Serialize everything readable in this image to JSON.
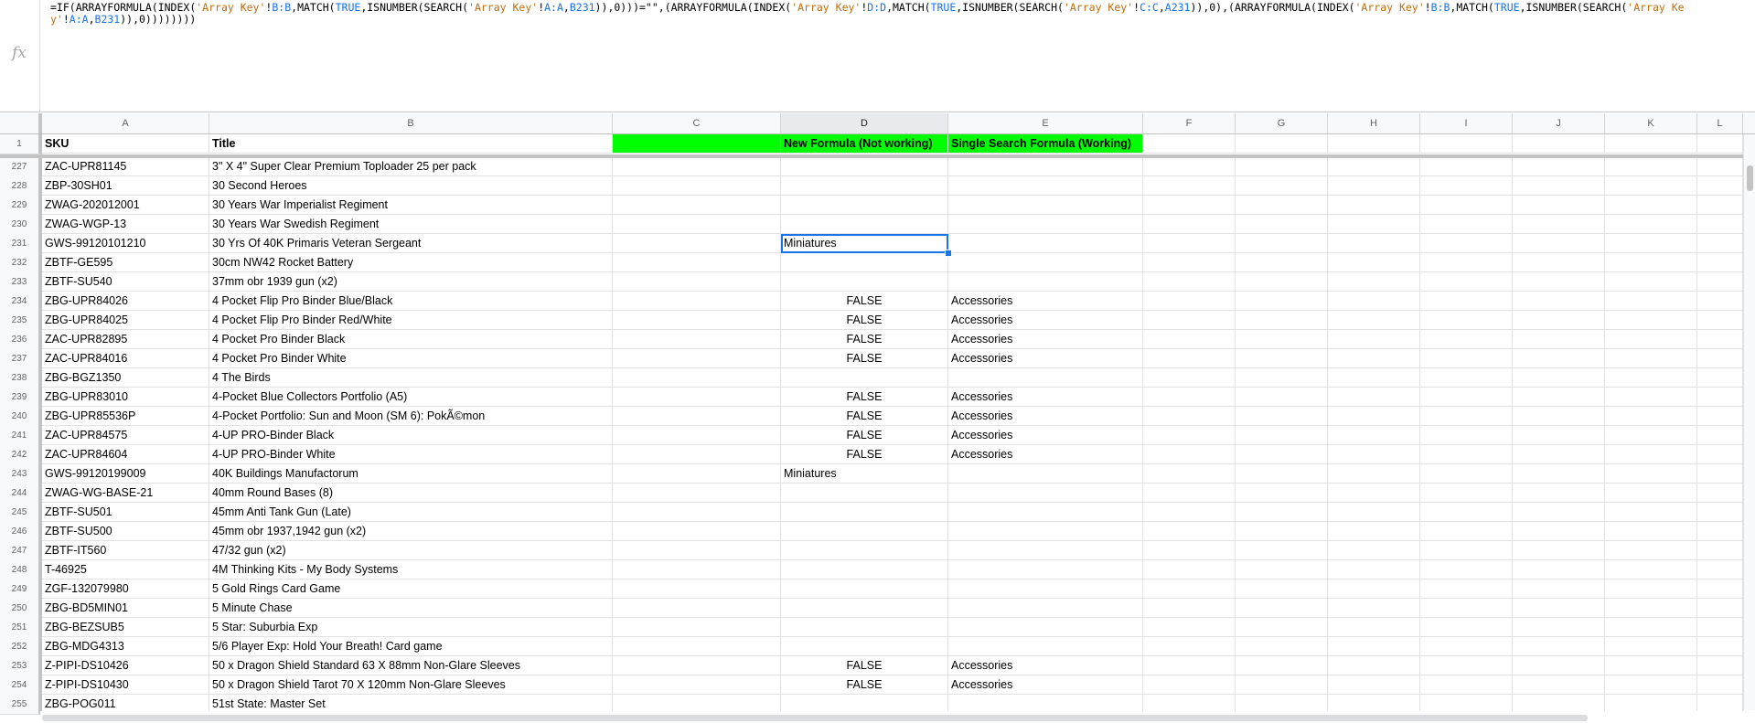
{
  "formula_bar": {
    "fx_label": "fx",
    "tokens": [
      {
        "t": "=IF(ARRAYFORMULA(INDEX(",
        "c": ""
      },
      {
        "t": "'Array Key'",
        "c": "str"
      },
      {
        "t": "!",
        "c": ""
      },
      {
        "t": "B:B",
        "c": "ref"
      },
      {
        "t": ",MATCH(",
        "c": ""
      },
      {
        "t": "TRUE",
        "c": "kw"
      },
      {
        "t": ",ISNUMBER(SEARCH(",
        "c": ""
      },
      {
        "t": "'Array Key'",
        "c": "str"
      },
      {
        "t": "!",
        "c": ""
      },
      {
        "t": "A:A",
        "c": "ref"
      },
      {
        "t": ",",
        "c": ""
      },
      {
        "t": "B231",
        "c": "ref"
      },
      {
        "t": ")),0)))=\"\",(ARRAYFORMULA(INDEX(",
        "c": ""
      },
      {
        "t": "'Array Key'",
        "c": "str"
      },
      {
        "t": "!",
        "c": ""
      },
      {
        "t": "D:D",
        "c": "ref"
      },
      {
        "t": ",MATCH(",
        "c": ""
      },
      {
        "t": "TRUE",
        "c": "kw"
      },
      {
        "t": ",ISNUMBER(SEARCH(",
        "c": ""
      },
      {
        "t": "'Array Key'",
        "c": "str"
      },
      {
        "t": "!",
        "c": ""
      },
      {
        "t": "C:C",
        "c": "ref"
      },
      {
        "t": ",",
        "c": ""
      },
      {
        "t": "A231",
        "c": "ref"
      },
      {
        "t": ")),0),(ARRAYFORMULA(INDEX(",
        "c": ""
      },
      {
        "t": "'Array Key'",
        "c": "str"
      },
      {
        "t": "!",
        "c": ""
      },
      {
        "t": "B:B",
        "c": "ref"
      },
      {
        "t": ",MATCH(",
        "c": ""
      },
      {
        "t": "TRUE",
        "c": "kw"
      },
      {
        "t": ",ISNUMBER(SEARCH(",
        "c": ""
      },
      {
        "t": "'Array Key'",
        "c": "str"
      },
      {
        "t": "!",
        "c": ""
      },
      {
        "t": "A:A",
        "c": "ref"
      },
      {
        "t": ",",
        "c": ""
      },
      {
        "t": "B231",
        "c": "ref"
      },
      {
        "t": ")),0))))))))",
        "c": ""
      }
    ]
  },
  "columns": [
    "A",
    "B",
    "C",
    "D",
    "E",
    "F",
    "G",
    "H",
    "I",
    "J",
    "K",
    "L"
  ],
  "selected_column": "D",
  "header_row": {
    "number": "1",
    "A": "SKU",
    "B": "Title",
    "C": "",
    "D": "New Formula (Not working)",
    "E": "Single Search Formula (Working)"
  },
  "colors": {
    "header_fill": "#00ff00",
    "selection": "#1a73e8",
    "string_token": "#bc6e10",
    "ref_token": "#1a73e8"
  },
  "selected_cell": "D231",
  "rows": [
    {
      "n": "227",
      "A": "ZAC-UPR81145",
      "B": "3\" X 4\" Super Clear Premium Toploader 25 per pack",
      "D": "",
      "E": ""
    },
    {
      "n": "228",
      "A": "ZBP-30SH01",
      "B": "30 Second Heroes",
      "D": "",
      "E": ""
    },
    {
      "n": "229",
      "A": "ZWAG-202012001",
      "B": "30 Years War Imperialist Regiment",
      "D": "",
      "E": ""
    },
    {
      "n": "230",
      "A": "ZWAG-WGP-13",
      "B": "30 Years War Swedish Regiment",
      "D": "",
      "E": ""
    },
    {
      "n": "231",
      "A": "GWS-99120101210",
      "B": "30 Yrs Of 40K Primaris Veteran Sergeant",
      "D": "Miniatures",
      "E": ""
    },
    {
      "n": "232",
      "A": "ZBTF-GE595",
      "B": "30cm NW42 Rocket Battery",
      "D": "",
      "E": ""
    },
    {
      "n": "233",
      "A": "ZBTF-SU540",
      "B": "37mm obr 1939 gun (x2)",
      "D": "",
      "E": ""
    },
    {
      "n": "234",
      "A": "ZBG-UPR84026",
      "B": "4 Pocket Flip Pro Binder Blue/Black",
      "D": "FALSE",
      "E": "Accessories"
    },
    {
      "n": "235",
      "A": "ZBG-UPR84025",
      "B": "4 Pocket Flip Pro Binder Red/White",
      "D": "FALSE",
      "E": "Accessories"
    },
    {
      "n": "236",
      "A": "ZAC-UPR82895",
      "B": "4 Pocket Pro Binder Black",
      "D": "FALSE",
      "E": "Accessories"
    },
    {
      "n": "237",
      "A": "ZAC-UPR84016",
      "B": "4 Pocket Pro Binder White",
      "D": "FALSE",
      "E": "Accessories"
    },
    {
      "n": "238",
      "A": "ZBG-BGZ1350",
      "B": "4 The Birds",
      "D": "",
      "E": ""
    },
    {
      "n": "239",
      "A": "ZBG-UPR83010",
      "B": "4-Pocket Blue Collectors Portfolio (A5)",
      "D": "FALSE",
      "E": "Accessories"
    },
    {
      "n": "240",
      "A": "ZBG-UPR85536P",
      "B": "4-Pocket Portfolio: Sun and Moon (SM 6): PokÃ©mon",
      "D": "FALSE",
      "E": "Accessories"
    },
    {
      "n": "241",
      "A": "ZAC-UPR84575",
      "B": "4-UP PRO-Binder Black",
      "D": "FALSE",
      "E": "Accessories"
    },
    {
      "n": "242",
      "A": "ZAC-UPR84604",
      "B": "4-UP PRO-Binder White",
      "D": "FALSE",
      "E": "Accessories"
    },
    {
      "n": "243",
      "A": "GWS-99120199009",
      "B": "40K Buildings Manufactorum",
      "D": "Miniatures",
      "E": ""
    },
    {
      "n": "244",
      "A": "ZWAG-WG-BASE-21",
      "B": "40mm Round Bases (8)",
      "D": "",
      "E": ""
    },
    {
      "n": "245",
      "A": "ZBTF-SU501",
      "B": "45mm Anti Tank Gun (Late)",
      "D": "",
      "E": ""
    },
    {
      "n": "246",
      "A": "ZBTF-SU500",
      "B": "45mm obr 1937,1942 gun (x2)",
      "D": "",
      "E": ""
    },
    {
      "n": "247",
      "A": "ZBTF-IT560",
      "B": "47/32 gun (x2)",
      "D": "",
      "E": ""
    },
    {
      "n": "248",
      "A": "T-46925",
      "B": "4M Thinking Kits - My Body Systems",
      "D": "",
      "E": ""
    },
    {
      "n": "249",
      "A": "ZGF-132079980",
      "B": "5 Gold Rings Card Game",
      "D": "",
      "E": ""
    },
    {
      "n": "250",
      "A": "ZBG-BD5MIN01",
      "B": "5 Minute Chase",
      "D": "",
      "E": ""
    },
    {
      "n": "251",
      "A": "ZBG-BEZSUB5",
      "B": "5 Star: Suburbia Exp",
      "D": "",
      "E": ""
    },
    {
      "n": "252",
      "A": "ZBG-MDG4313",
      "B": "5/6 Player Exp: Hold Your Breath! Card game",
      "D": "",
      "E": ""
    },
    {
      "n": "253",
      "A": "Z-PIPI-DS10426",
      "B": "50 x Dragon Shield Standard 63 X 88mm Non-Glare Sleeves",
      "D": "FALSE",
      "E": "Accessories"
    },
    {
      "n": "254",
      "A": "Z-PIPI-DS10430",
      "B": "50 x Dragon Shield Tarot 70 X 120mm Non-Glare Sleeves",
      "D": "FALSE",
      "E": "Accessories"
    },
    {
      "n": "255",
      "A": "ZBG-POG011",
      "B": "51st State: Master Set",
      "D": "",
      "E": ""
    }
  ]
}
